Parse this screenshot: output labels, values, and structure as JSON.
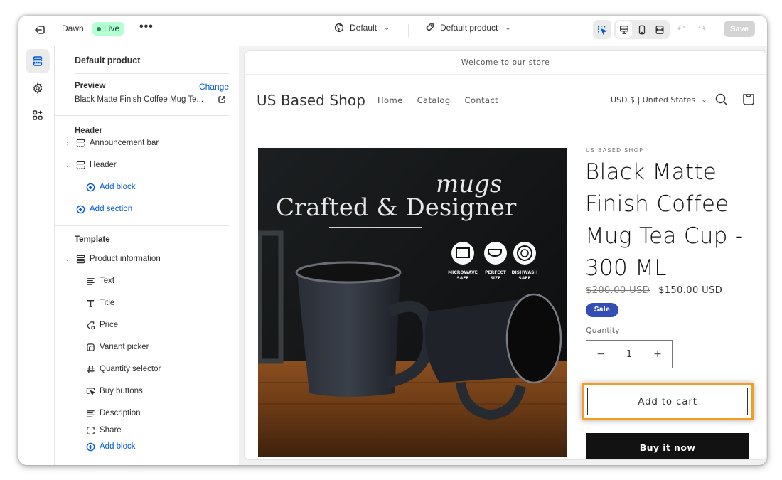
{
  "topbar": {
    "theme_name": "Dawn",
    "status_badge": "Live",
    "more_label": "•••",
    "theme_selector": "Default",
    "template_selector": "Default product",
    "save_label": "Save",
    "undo_label": "↶",
    "redo_label": "↷"
  },
  "rail": {
    "items": [
      {
        "icon": "sections-icon",
        "active": true
      },
      {
        "icon": "gear-icon",
        "active": false
      },
      {
        "icon": "apps-add-icon",
        "active": false
      }
    ]
  },
  "sidebar": {
    "title": "Default product",
    "preview": {
      "label": "Preview",
      "change_label": "Change",
      "value": "Black Matte Finish Coffee Mug Te..."
    },
    "header_group": {
      "title": "Header",
      "items": [
        {
          "label": "Announcement bar",
          "expanded": false
        },
        {
          "label": "Header",
          "expanded": true
        }
      ],
      "add_block": "Add block",
      "add_section": "Add section"
    },
    "template_group": {
      "title": "Template",
      "section": "Product information",
      "blocks": [
        {
          "label": "Text",
          "icon": "text-lines-icon"
        },
        {
          "label": "Title",
          "icon": "title-t-icon"
        },
        {
          "label": "Price",
          "icon": "price-tag-icon"
        },
        {
          "label": "Variant picker",
          "icon": "variant-icon"
        },
        {
          "label": "Quantity selector",
          "icon": "hash-icon"
        },
        {
          "label": "Buy buttons",
          "icon": "cursor-button-icon"
        },
        {
          "label": "Description",
          "icon": "text-lines-icon"
        },
        {
          "label": "Share",
          "icon": "share-frame-icon"
        }
      ],
      "add_block": "Add block"
    }
  },
  "store": {
    "announcement": "Welcome to our store",
    "logo": "US Based Shop",
    "nav": [
      "Home",
      "Catalog",
      "Contact"
    ],
    "currency": "USD $ | United States",
    "product": {
      "vendor": "US BASED SHOP",
      "title": "Black Matte Finish Coffee Mug Tea Cup - 300 ML",
      "compare_price": "$200.00 USD",
      "price": "$150.00 USD",
      "badge": "Sale",
      "quantity_label": "Quantity",
      "quantity": "1",
      "minus": "−",
      "plus": "+",
      "add_to_cart": "Add to cart",
      "buy_now": "Buy it now",
      "image_text": {
        "headline": "Crafted & Designer",
        "script": "mugs",
        "badges": [
          {
            "line1": "MICROWAVE",
            "line2": "SAFE"
          },
          {
            "line1": "PERFECT",
            "line2": "SIZE"
          },
          {
            "line1": "DISHWASH",
            "line2": "SAFE"
          }
        ]
      }
    }
  },
  "colors": {
    "accent_blue": "#005bd3",
    "live_badge_bg": "#b4fed2",
    "sale_badge": "#334fb4",
    "highlight_orange": "#f39c1f",
    "buy_now_bg": "#121212"
  }
}
